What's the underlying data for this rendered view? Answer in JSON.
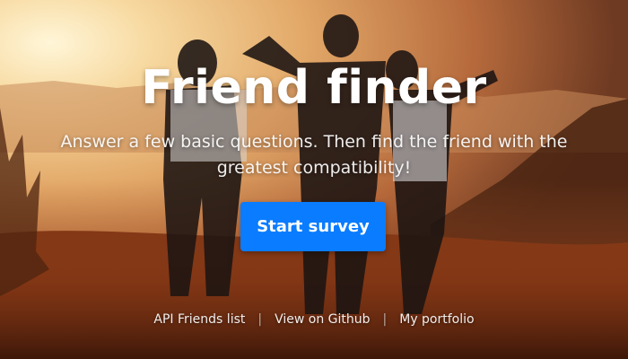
{
  "hero": {
    "title": "Friend finder",
    "subtitle": "Answer a few basic questions. Then find the friend with the greatest compatibility!",
    "cta_label": "Start survey",
    "background_description_colors": {
      "sky": "#f3c98a",
      "sun": "#fff6d8",
      "mountains": "#a4643a",
      "foreground": "#5a2710"
    },
    "button_color": "#0a7cff"
  },
  "footer": {
    "links": [
      {
        "label": "API Friends list"
      },
      {
        "label": "View on Github"
      },
      {
        "label": "My portfolio"
      }
    ],
    "separator": "|"
  }
}
